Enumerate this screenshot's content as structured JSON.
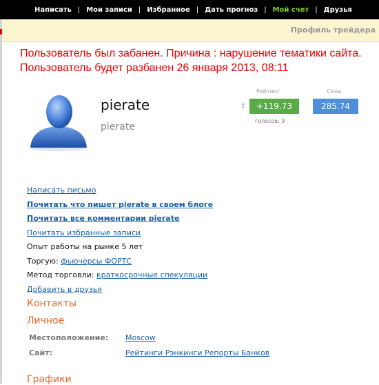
{
  "nav": {
    "items": [
      "Написать",
      "Мои записи",
      "Избранное",
      "Дать прогноз",
      "Мой счет",
      "Друзья"
    ],
    "active_index": 4,
    "separator": "|"
  },
  "header": {
    "title": "Профиль трейдера"
  },
  "ban_message": "Пользователь был забанен. Причина : нарушение тематики сайта. Пользователь будет разбанен 26 января 2013, 08:11",
  "user": {
    "name": "pierate",
    "nickname": "pierate"
  },
  "rating": {
    "label": "Рейтинг",
    "value": "+119.73",
    "votes": "голосов: 9",
    "color": "#5aaa48"
  },
  "power": {
    "label": "Сила",
    "value": "285.74",
    "color": "#4f8fd8"
  },
  "links": {
    "write_letter": "Написать письмо",
    "read_blog": "Почитать что пишет pierate в своем блоге",
    "read_comments": "Почитать все комментарии pierate",
    "read_favorites": "Почитать избранные записи",
    "experience": "Опыт работы на рынке 5 лет",
    "trades_label": "Торгую:",
    "trades_value": "фьючерсы ФОРТС",
    "method_label": "Метод торговли:",
    "method_value": "краткосрочные спекуляции",
    "add_friend": "Добавить в друзья"
  },
  "sections": {
    "contacts": "Контакты",
    "personal": "Личное",
    "charts": "Графики"
  },
  "personal": {
    "location_label": "Местоположение:",
    "location_value": "Moscow",
    "site_label": "Сайт:",
    "site_value": "Рейтинги Рэнкинги Репорты Банков"
  }
}
